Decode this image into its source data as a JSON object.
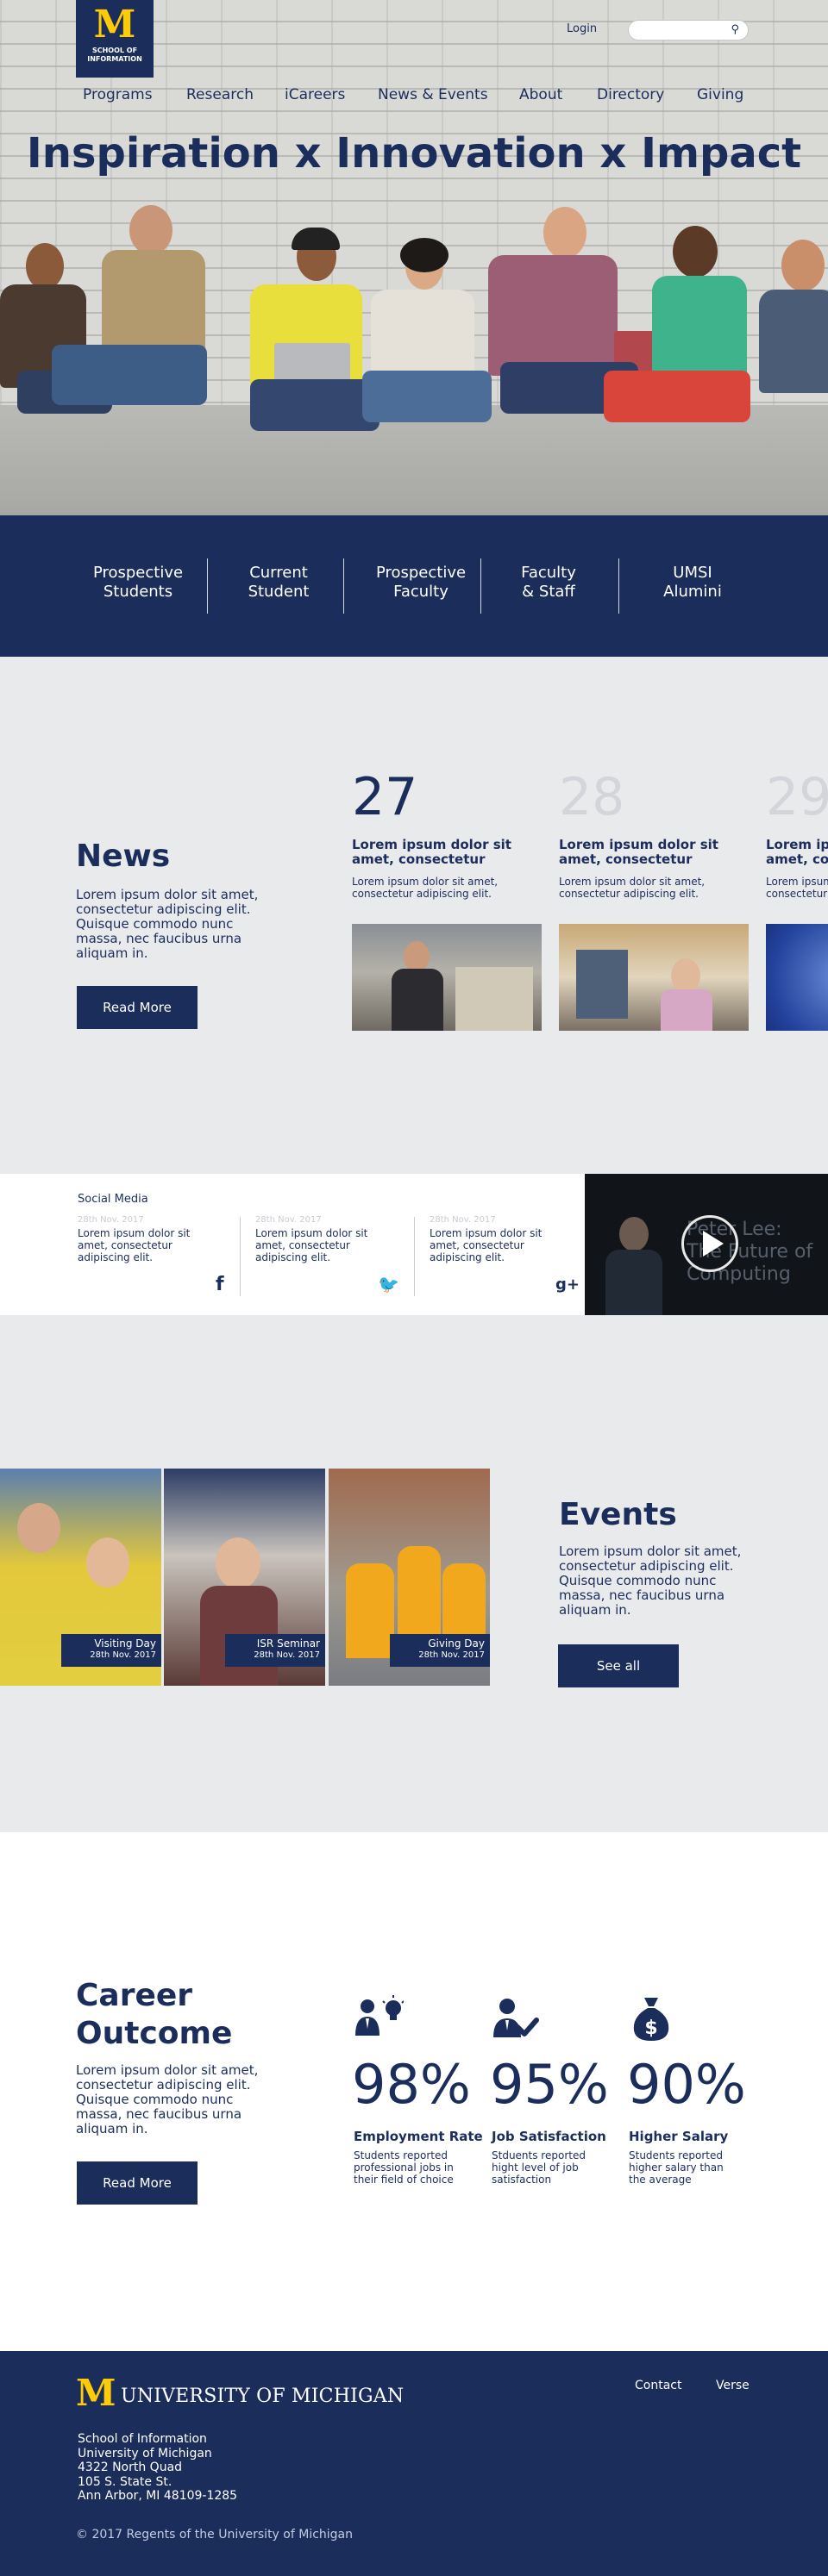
{
  "header": {
    "logo_letter": "M",
    "logo_text": "SCHOOL OF INFORMATION",
    "login_label": "Login",
    "search_placeholder": "",
    "search_icon": "search-icon"
  },
  "nav": {
    "items": [
      "Programs",
      "Research",
      "iCareers",
      "News & Events",
      "About",
      "Directory",
      "Giving"
    ]
  },
  "hero": {
    "title_pre": "Inspiration x ",
    "title_bold": "Innovation",
    "title_post": " x Impact"
  },
  "audience": {
    "items": [
      {
        "line1": "Prospective",
        "line2": "Students"
      },
      {
        "line1": "Current",
        "line2": "Student"
      },
      {
        "line1": "Prospective",
        "line2": "Faculty"
      },
      {
        "line1": "Faculty",
        "line2": "& Staff"
      },
      {
        "line1": "UMSI",
        "line2": "Alumini"
      }
    ]
  },
  "news": {
    "heading": "News",
    "text": "Lorem ipsum dolor sit amet, consectetur adipiscing elit. Quisque commodo nunc massa, nec faucibus urna aliquam in.",
    "button": "Read More",
    "cards": [
      {
        "day": "27",
        "title": "Lorem ipsum dolor sit amet, consectetur",
        "text": "Lorem ipsum dolor sit amet, consectetur adipiscing elit."
      },
      {
        "day": "28",
        "title": "Lorem ipsum dolor sit amet, consectetur",
        "text": "Lorem ipsum dolor sit amet, consectetur adipiscing elit."
      },
      {
        "day": "29",
        "title": "Lorem ipsum dolor sit amet, consectetur",
        "text": "Lorem ipsum dolor sit amet, consectetur adipiscing elit."
      }
    ]
  },
  "social": {
    "heading": "Social Media",
    "posts": [
      {
        "date": "28th Nov. 2017",
        "text": "Lorem ipsum dolor sit amet, consectetur adipiscing elit.",
        "icon": "facebook-icon",
        "glyph": "f"
      },
      {
        "date": "28th Nov. 2017",
        "text": "Lorem ipsum dolor sit amet, consectetur adipiscing elit.",
        "icon": "twitter-icon",
        "glyph": "🐦"
      },
      {
        "date": "28th Nov. 2017",
        "text": "Lorem ipsum dolor sit amet, consectetur adipiscing elit.",
        "icon": "google-plus-icon",
        "glyph": "g+"
      }
    ],
    "video_text": "Peter Lee: The Future of Computing",
    "play_icon": "play-icon"
  },
  "events": {
    "heading": "Events",
    "text": "Lorem ipsum dolor sit amet, consectetur adipiscing elit. Quisque commodo nunc massa, nec faucibus urna aliquam in.",
    "button": "See all",
    "items": [
      {
        "name": "Visiting Day",
        "date": "28th Nov. 2017"
      },
      {
        "name": "ISR Seminar",
        "date": "28th Nov. 2017"
      },
      {
        "name": "Giving Day",
        "date": "28th Nov. 2017"
      }
    ]
  },
  "career": {
    "heading_line1": "Career",
    "heading_line2": "Outcome",
    "text": "Lorem ipsum dolor sit amet, consectetur adipiscing elit. Quisque commodo nunc massa, nec faucibus urna aliquam in.",
    "button": "Read More",
    "stats": [
      {
        "value": "98%",
        "label": "Employment Rate",
        "desc": "Students reported professional jobs in their field of choice",
        "icon": "employee-lightbulb-icon"
      },
      {
        "value": "95%",
        "label": "Job Satisfaction",
        "desc": "Stduents reported hight level of job satisfaction",
        "icon": "employee-check-icon"
      },
      {
        "value": "90%",
        "label": "Higher Salary",
        "desc": "Students reported higher salary than the average",
        "icon": "money-bag-icon"
      }
    ]
  },
  "footer": {
    "logo_letter": "M",
    "university": "UNIVERSITY OF MICHIGAN",
    "links": [
      "Contact",
      "Verse"
    ],
    "address": [
      "School of Information",
      "University of Michigan",
      "4322 North Quad",
      "105 S. State St.",
      "Ann Arbor, MI 48109-1285"
    ],
    "copyright": "© 2017 Regents of the University of Michigan"
  },
  "colors": {
    "brand_navy": "#1b2d5b",
    "brand_maize": "#ffcb05",
    "section_gray": "#e9eaec"
  }
}
